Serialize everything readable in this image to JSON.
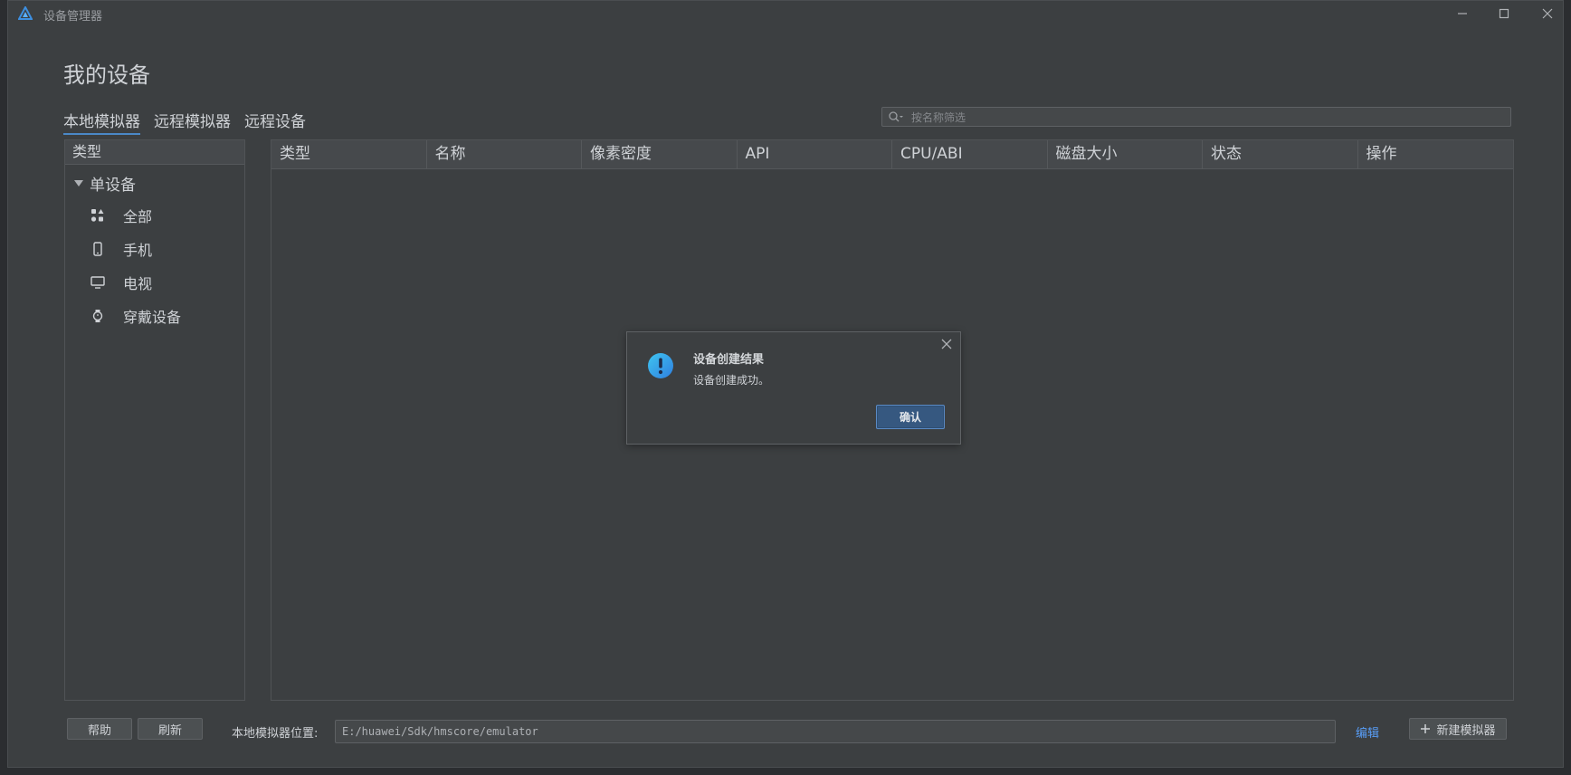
{
  "window": {
    "title": "设备管理器"
  },
  "page": {
    "title": "我的设备"
  },
  "tabs": [
    {
      "label": "本地模拟器",
      "active": true
    },
    {
      "label": "远程模拟器",
      "active": false
    },
    {
      "label": "远程设备",
      "active": false
    }
  ],
  "search": {
    "placeholder": "按名称筛选"
  },
  "sidebar": {
    "header": "类型",
    "group": "单设备",
    "items": [
      {
        "label": "全部",
        "icon": "grid-icon"
      },
      {
        "label": "手机",
        "icon": "phone-icon"
      },
      {
        "label": "电视",
        "icon": "tv-icon"
      },
      {
        "label": "穿戴设备",
        "icon": "watch-icon"
      }
    ]
  },
  "table": {
    "columns": [
      "类型",
      "名称",
      "像素密度",
      "API",
      "CPU/ABI",
      "磁盘大小",
      "状态",
      "操作"
    ],
    "rows": []
  },
  "dialog": {
    "title": "设备创建结果",
    "message": "设备创建成功。",
    "ok_label": "确认"
  },
  "footer": {
    "help_label": "帮助",
    "refresh_label": "刷新",
    "path_label": "本地模拟器位置:",
    "path_value": "E:/huawei/Sdk/hmscore/emulator",
    "edit_label": "编辑",
    "new_label": "新建模拟器"
  },
  "colors": {
    "accent": "#4a88c7",
    "link": "#589df6",
    "button_primary": "#365880",
    "background": "#3c3f41"
  }
}
